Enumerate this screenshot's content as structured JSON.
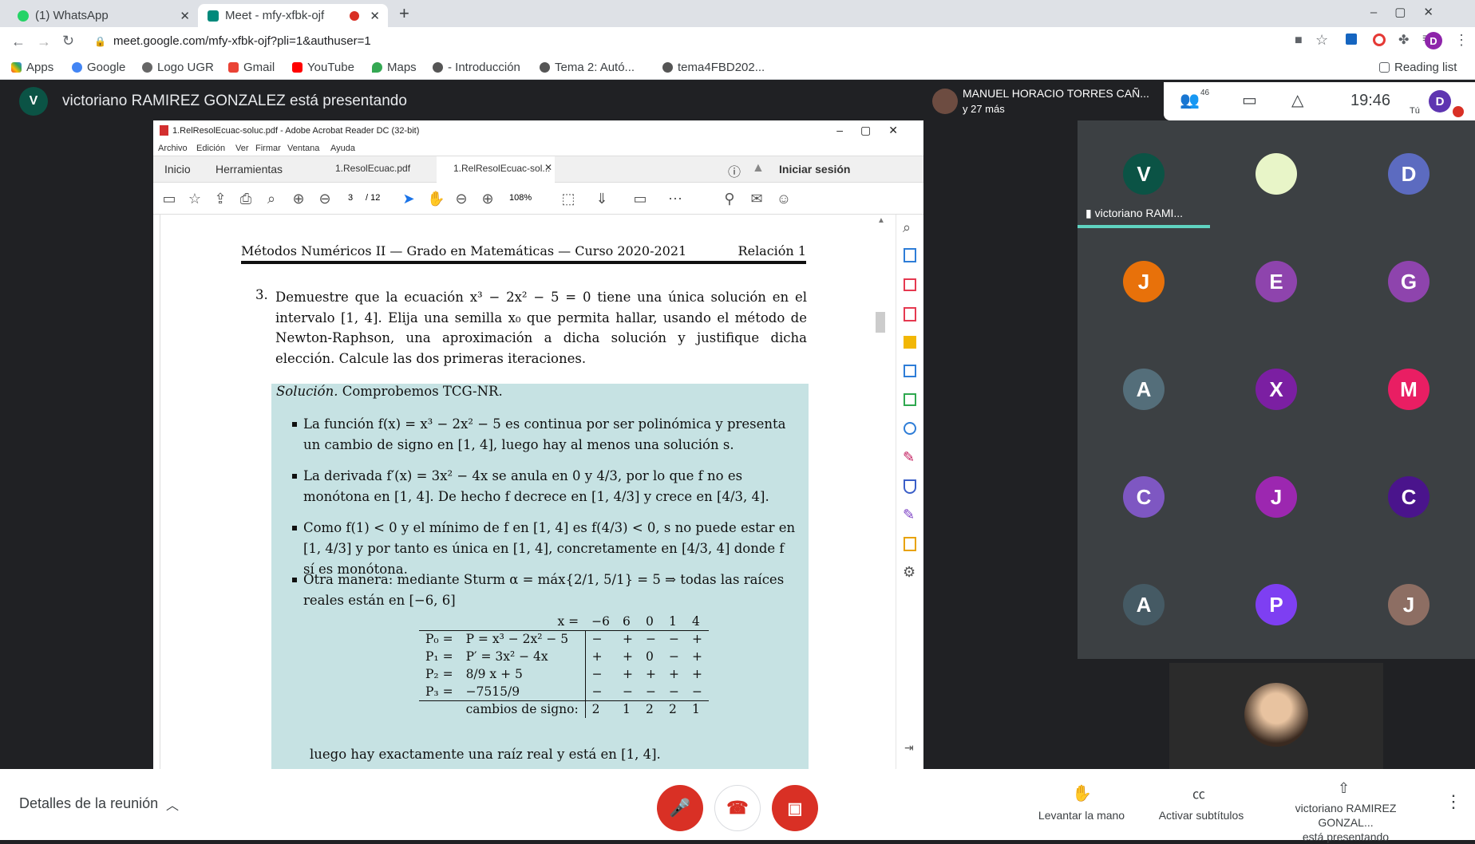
{
  "browser": {
    "tabs": [
      {
        "label": "(1) WhatsApp"
      },
      {
        "label": "Meet - mfy-xfbk-ojf"
      }
    ],
    "url": "meet.google.com/mfy-xfbk-ojf?pli=1&authuser=1",
    "profile_initial": "D",
    "bookmarks": [
      "Apps",
      "Google",
      "Logo UGR",
      "Gmail",
      "YouTube",
      "Maps",
      "- Introducción",
      "Tema 2: Autó...",
      "tema4FBD202..."
    ],
    "reading_list": "Reading list"
  },
  "meet": {
    "presenter_initial": "V",
    "presenter_text": "victoriano RAMIREZ GONZALEZ está presentando",
    "top_user": "MANUEL HORACIO TORRES CAÑ...",
    "top_more": "y 27 más",
    "people_count": "46",
    "time": "19:46",
    "self_label": "Tú",
    "self_initial": "D",
    "speaker_label": "victoriano RAMI...",
    "grid": [
      {
        "initial": "V",
        "color": "#0b5345"
      },
      {
        "initial": "",
        "color": "#e8f5c8"
      },
      {
        "initial": "D",
        "color": "#5c6bc0"
      },
      {
        "initial": "J",
        "color": "#e8710a"
      },
      {
        "initial": "E",
        "color": "#8e44ad"
      },
      {
        "initial": "G",
        "color": "#8e44ad"
      },
      {
        "initial": "A",
        "color": "#546e7a"
      },
      {
        "initial": "X",
        "color": "#7b1fa2"
      },
      {
        "initial": "M",
        "color": "#e91e63"
      },
      {
        "initial": "C",
        "color": "#7e57c2"
      },
      {
        "initial": "J",
        "color": "#9c27b0"
      },
      {
        "initial": "C",
        "color": "#4a148c"
      },
      {
        "initial": "A",
        "color": "#455a64"
      },
      {
        "initial": "P",
        "color": "#7e3ff2"
      },
      {
        "initial": "J",
        "color": "#8d6e63"
      }
    ],
    "details": "Detalles de la reunión",
    "raise_hand": "Levantar la mano",
    "captions": "Activar subtítulos",
    "presenting_line1": "victoriano RAMIREZ GONZAL...",
    "presenting_line2": "está presentando"
  },
  "acrobat": {
    "title": "1.RelResolEcuac-soluc.pdf - Adobe Acrobat Reader DC (32-bit)",
    "menu": [
      "Archivo",
      "Edición",
      "Ver",
      "Firmar",
      "Ventana",
      "Ayuda"
    ],
    "tabs": [
      "Inicio",
      "Herramientas",
      "1.ResolEcuac.pdf",
      "1.RelResolEcuac-sol..."
    ],
    "signin": "Iniciar sesión",
    "page_current": "3",
    "page_total": "/ 12",
    "zoom": "108%"
  },
  "doc": {
    "header_left": "Métodos Numéricos II — Grado en Matemáticas — Curso 2020-2021",
    "header_right": "Relación 1",
    "q_num": "3.",
    "q_text": "Demuestre que la ecuación x³ − 2x² − 5 = 0 tiene una única solución en el intervalo [1, 4]. Elija una semilla x₀ que permita hallar, usando el método de Newton-Raphson, una aproximación a dicha solución y justifique dicha elección. Calcule las dos primeras iteraciones.",
    "sol_title": "Solución.",
    "sol_intro": "Comprobemos TCG-NR.",
    "bullets": [
      "La función f(x) = x³ − 2x² − 5 es continua por ser polinómica y presenta un cambio de signo en [1, 4], luego hay al menos una solución s.",
      "La derivada f′(x) = 3x² − 4x se anula en 0 y 4/3, por lo que f no es monótona en [1, 4]. De hecho f decrece en [1, 4/3] y crece en [4/3, 4].",
      "Como f(1) < 0 y el mínimo de f en [1, 4] es f(4/3) < 0, s no puede estar en [1, 4/3] y por tanto es única en [1, 4], concretamente en [4/3, 4] donde f sí es monótona.",
      "Otra manera: mediante Sturm α = máx{2/1, 5/1} = 5 ⇒ todas las raíces reales están en [−6, 6]"
    ],
    "sturm": {
      "header": [
        "x =",
        "−6",
        "6",
        "0",
        "1",
        "4"
      ],
      "rows": [
        [
          "P₀ =",
          "P = x³ − 2x² − 5",
          "−",
          "+",
          "−",
          "−",
          "+"
        ],
        [
          "P₁ =",
          "P′ = 3x² − 4x",
          "+",
          "+",
          "0",
          "−",
          "+"
        ],
        [
          "P₂ =",
          "8/9 x + 5",
          "−",
          "+",
          "+",
          "+",
          "+"
        ],
        [
          "P₃ =",
          "−7515/9",
          "−",
          "−",
          "−",
          "−",
          "−"
        ]
      ],
      "footer": [
        "cambios de signo:",
        "2",
        "1",
        "2",
        "2",
        "1"
      ]
    },
    "conclusion": "luego hay exactamente una raíz real y está en [1, 4]."
  }
}
